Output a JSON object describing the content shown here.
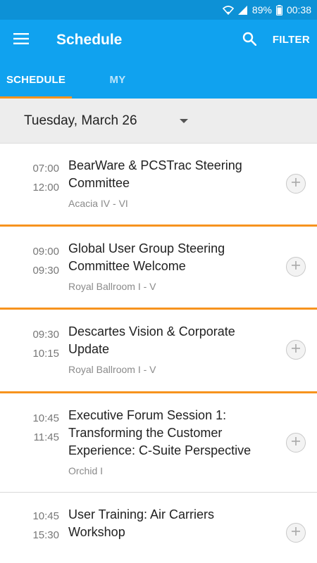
{
  "status_bar": {
    "battery": "89%",
    "time": "00:38"
  },
  "app_bar": {
    "title": "Schedule",
    "filter_label": "FILTER"
  },
  "tabs": [
    {
      "label": "SCHEDULE",
      "active": true
    },
    {
      "label": "MY SCHEDULE",
      "active": false
    }
  ],
  "date_selector": {
    "selected": "Tuesday, March 26"
  },
  "colors": {
    "primary": "#10a2ef",
    "status_bar": "#0d91d6",
    "accent": "#f7931e"
  },
  "sessions": [
    {
      "start": "07:00",
      "end": "12:00",
      "title_lines": [
        "BearWare & PCSTrac Steering",
        "Committee"
      ],
      "room": "Acacia IV - VI"
    },
    {
      "start": "09:00",
      "end": "09:30",
      "title_lines": [
        "Global User Group Steering",
        "Committee Welcome"
      ],
      "room": "Royal Ballroom I - V"
    },
    {
      "start": "09:30",
      "end": "10:15",
      "title_lines": [
        "Descartes Vision & Corporate",
        "Update"
      ],
      "room": "Royal Ballroom I - V"
    },
    {
      "start": "10:45",
      "end": "11:45",
      "title_lines": [
        "Executive Forum Session 1:",
        "Transforming the Customer",
        "Experience: C-Suite Perspective"
      ],
      "room": "Orchid I"
    },
    {
      "start": "10:45",
      "end": "15:30",
      "title_lines": [
        "User Training: Air Carriers",
        "Workshop"
      ],
      "room": ""
    }
  ]
}
